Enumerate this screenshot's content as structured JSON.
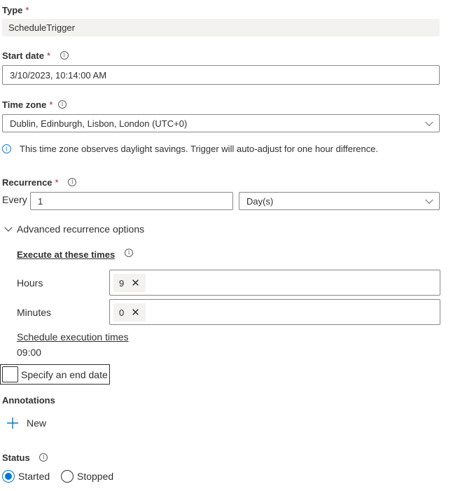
{
  "type": {
    "label": "Type",
    "required": "*",
    "value": "ScheduleTrigger"
  },
  "start_date": {
    "label": "Start date",
    "required": "*",
    "value": "3/10/2023, 10:14:00 AM"
  },
  "time_zone": {
    "label": "Time zone",
    "required": "*",
    "value": "Dublin, Edinburgh, Lisbon, London (UTC+0)",
    "note": "This time zone observes daylight savings. Trigger will auto-adjust for one hour difference."
  },
  "recurrence": {
    "label": "Recurrence",
    "required": "*",
    "every_label": "Every",
    "interval": "1",
    "unit": "Day(s)"
  },
  "advanced": {
    "toggle_label": "Advanced recurrence options",
    "execute_label": "Execute at these times",
    "hours_label": "Hours",
    "hours_chip": "9",
    "minutes_label": "Minutes",
    "minutes_chip": "0",
    "chip_remove": "✕",
    "schedule_label": "Schedule execution times",
    "schedule_value": "09:00"
  },
  "end_date": {
    "label": "Specify an end date"
  },
  "annotations": {
    "label": "Annotations",
    "new_label": "New"
  },
  "status": {
    "label": "Status",
    "started": "Started",
    "stopped": "Stopped",
    "selected": "Started"
  },
  "colors": {
    "accent": "#0078d4",
    "required": "#a4262c",
    "text": "#323130"
  }
}
